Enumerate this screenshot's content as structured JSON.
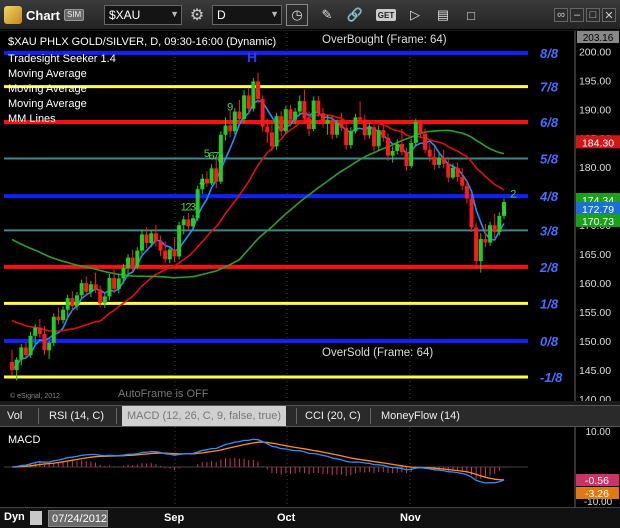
{
  "toolbar": {
    "app_title": "Chart",
    "sim_badge": "SIM",
    "symbol": "$XAU",
    "interval": "D",
    "get_label": "GET"
  },
  "price_header": {
    "line1": "$XAU PHLX GOLD/SILVER, D, 09:30-16:00 (Dynamic)",
    "studies": [
      "Tradesight Seeker 1.4",
      "Moving Average",
      "Moving Average",
      "Moving Average",
      "MM Lines"
    ],
    "overbought": "OverBought (Frame: 64)",
    "oversold": "OverSold (Frame: 64)",
    "autoframe": "AutoFrame is OFF",
    "copyright": "© eSignal, 2012",
    "h_marker": "H"
  },
  "study_tabs": [
    {
      "label": "Vol",
      "active": false
    },
    {
      "label": "RSI (14, C)",
      "active": false
    },
    {
      "label": "MACD (12, 26, C, 9, false, true)",
      "active": true
    },
    {
      "label": "CCI (20, C)",
      "active": false
    },
    {
      "label": "MoneyFlow (14)",
      "active": false
    }
  ],
  "macd_panel": {
    "label": "MACD",
    "scale_top": "10.00",
    "scale_bottom": "-10.00",
    "macd_value": "-0.56",
    "signal_value": "-3.26"
  },
  "bottom_bar": {
    "dyn_label": "Dyn",
    "date": "07/24/2012",
    "months": [
      "Sep",
      "Oct",
      "Nov"
    ]
  },
  "colors": {
    "up": "#22cc22",
    "down": "#ff1a1a",
    "ma_fast": "#1e90ff",
    "ma_mid": "#e01010",
    "ma_slow": "#2e9e2e",
    "mm_blue": "#1020ff",
    "mm_yellow": "#ffff40",
    "mm_red": "#ff1010",
    "mm_teal": "#3a8a8a"
  },
  "chart_data": {
    "type": "candlestick",
    "title": "$XAU PHLX GOLD/SILVER, D, 09:30-16:00 (Dynamic)",
    "ylim": [
      140.0,
      203.16
    ],
    "y_ticks": [
      140,
      145,
      150,
      155,
      160,
      165,
      170,
      175,
      180,
      185,
      190,
      195,
      200
    ],
    "last_label": "203.16",
    "x_labels": [
      "Sep",
      "Oct",
      "Nov"
    ],
    "murrey_math_lines": [
      {
        "label": "8/8",
        "value": 199.7,
        "color": "blue"
      },
      {
        "label": "7/8",
        "value": 193.9,
        "color": "yellow"
      },
      {
        "label": "6/8",
        "value": 187.8,
        "color": "red"
      },
      {
        "label": "5/8",
        "value": 181.5,
        "color": "teal"
      },
      {
        "label": "4/8",
        "value": 175.0,
        "color": "blue"
      },
      {
        "label": "3/8",
        "value": 169.1,
        "color": "teal"
      },
      {
        "label": "2/8",
        "value": 162.8,
        "color": "red"
      },
      {
        "label": "1/8",
        "value": 156.5,
        "color": "yellow"
      },
      {
        "label": "0/8",
        "value": 150.0,
        "color": "blue"
      },
      {
        "label": "-1/8",
        "value": 143.8,
        "color": "yellow"
      }
    ],
    "price_tags": [
      {
        "value": 184.3,
        "label": "184.30",
        "color": "red"
      },
      {
        "value": 174.34,
        "label": "174.34",
        "color": "green"
      },
      {
        "value": 172.79,
        "label": "172.79",
        "color": "blue"
      },
      {
        "value": 170.73,
        "label": "170.73",
        "color": "green"
      }
    ],
    "seeker_counts": [
      {
        "bar": 37,
        "text": "1",
        "value": 172.5
      },
      {
        "bar": 38,
        "text": "2",
        "value": 172.5
      },
      {
        "bar": 39,
        "text": "3",
        "value": 172.5
      },
      {
        "bar": 41,
        "text": "4",
        "value": 176.8
      },
      {
        "bar": 42,
        "text": "5",
        "value": 181.8
      },
      {
        "bar": 43,
        "text": "6",
        "value": 181.3
      },
      {
        "bar": 44,
        "text": "7",
        "value": 181.3
      },
      {
        "bar": 45,
        "text": "8",
        "value": 180.8
      },
      {
        "bar": 47,
        "text": "9",
        "value": 189.8
      },
      {
        "bar": 106,
        "text": "1",
        "value": 172.0
      },
      {
        "bar": 108,
        "text": "2",
        "value": 174.8
      }
    ],
    "candles": [
      [
        146.4,
        148.5,
        144.1,
        145.0
      ],
      [
        145.0,
        147.2,
        143.2,
        146.8
      ],
      [
        146.8,
        149.5,
        145.8,
        148.9
      ],
      [
        148.9,
        149.8,
        147.0,
        147.6
      ],
      [
        147.6,
        151.6,
        147.1,
        150.9
      ],
      [
        150.9,
        152.9,
        149.5,
        152.3
      ],
      [
        152.3,
        153.8,
        150.5,
        151.2
      ],
      [
        151.2,
        152.6,
        147.6,
        148.4
      ],
      [
        148.4,
        150.1,
        146.9,
        149.7
      ],
      [
        149.7,
        154.8,
        149.1,
        154.2
      ],
      [
        154.2,
        155.8,
        152.9,
        153.6
      ],
      [
        153.6,
        156.0,
        153.0,
        155.4
      ],
      [
        155.4,
        158.0,
        154.2,
        157.4
      ],
      [
        157.4,
        158.6,
        155.2,
        156.0
      ],
      [
        156.0,
        158.5,
        155.3,
        157.9
      ],
      [
        157.9,
        160.6,
        157.2,
        160.0
      ],
      [
        160.0,
        161.2,
        157.8,
        158.5
      ],
      [
        158.5,
        160.4,
        157.6,
        159.8
      ],
      [
        159.8,
        161.8,
        158.3,
        158.9
      ],
      [
        158.9,
        159.6,
        155.8,
        156.5
      ],
      [
        156.5,
        158.2,
        155.7,
        157.7
      ],
      [
        157.7,
        161.6,
        157.0,
        160.9
      ],
      [
        160.9,
        162.4,
        158.2,
        159.0
      ],
      [
        159.0,
        161.6,
        158.2,
        160.8
      ],
      [
        160.8,
        163.3,
        159.9,
        162.6
      ],
      [
        162.6,
        165.0,
        161.1,
        164.4
      ],
      [
        164.4,
        165.8,
        162.0,
        162.8
      ],
      [
        162.8,
        166.2,
        162.4,
        165.6
      ],
      [
        165.6,
        169.2,
        165.0,
        168.4
      ],
      [
        168.4,
        169.6,
        166.0,
        166.9
      ],
      [
        166.9,
        169.2,
        166.2,
        168.6
      ],
      [
        168.6,
        170.0,
        166.3,
        167.2
      ],
      [
        167.2,
        168.2,
        164.7,
        165.6
      ],
      [
        165.6,
        167.2,
        163.4,
        164.1
      ],
      [
        164.1,
        166.2,
        163.4,
        165.8
      ],
      [
        165.8,
        167.9,
        163.6,
        164.6
      ],
      [
        164.6,
        170.6,
        164.1,
        170.0
      ],
      [
        170.0,
        171.6,
        168.4,
        171.0
      ],
      [
        171.0,
        172.1,
        169.2,
        169.8
      ],
      [
        169.8,
        171.8,
        169.4,
        171.2
      ],
      [
        171.2,
        176.8,
        170.7,
        176.2
      ],
      [
        176.2,
        178.8,
        175.4,
        178.0
      ],
      [
        178.0,
        179.3,
        176.6,
        177.2
      ],
      [
        177.2,
        180.5,
        176.9,
        179.8
      ],
      [
        179.8,
        181.8,
        176.4,
        177.5
      ],
      [
        177.5,
        186.2,
        177.1,
        185.6
      ],
      [
        185.6,
        188.6,
        184.6,
        187.2
      ],
      [
        187.2,
        189.8,
        185.2,
        186.2
      ],
      [
        186.2,
        190.2,
        185.7,
        189.6
      ],
      [
        189.6,
        191.6,
        187.5,
        188.3
      ],
      [
        188.3,
        193.3,
        187.6,
        192.4
      ],
      [
        192.4,
        193.7,
        189.2,
        190.1
      ],
      [
        190.1,
        195.4,
        189.6,
        194.8
      ],
      [
        194.8,
        196.3,
        191.0,
        191.8
      ],
      [
        191.8,
        192.4,
        186.2,
        187.0
      ],
      [
        187.0,
        188.4,
        184.2,
        186.0
      ],
      [
        186.0,
        187.8,
        182.8,
        183.6
      ],
      [
        183.6,
        189.4,
        183.0,
        188.8
      ],
      [
        188.8,
        189.6,
        185.4,
        186.2
      ],
      [
        186.2,
        190.6,
        185.8,
        190.0
      ],
      [
        190.0,
        190.8,
        187.0,
        188.2
      ],
      [
        188.2,
        190.2,
        187.4,
        189.6
      ],
      [
        189.6,
        192.4,
        189.0,
        191.4
      ],
      [
        191.4,
        193.4,
        187.6,
        188.4
      ],
      [
        188.4,
        189.6,
        185.4,
        186.6
      ],
      [
        186.6,
        192.2,
        186.2,
        191.5
      ],
      [
        191.5,
        192.3,
        188.7,
        189.3
      ],
      [
        189.3,
        190.2,
        186.8,
        187.5
      ],
      [
        187.5,
        189.0,
        185.6,
        188.2
      ],
      [
        188.2,
        188.8,
        184.8,
        185.6
      ],
      [
        185.6,
        188.2,
        185.0,
        187.6
      ],
      [
        187.6,
        189.4,
        186.2,
        186.8
      ],
      [
        186.8,
        187.4,
        183.0,
        183.8
      ],
      [
        183.8,
        186.9,
        183.2,
        186.2
      ],
      [
        186.2,
        189.2,
        185.8,
        188.6
      ],
      [
        188.6,
        191.4,
        187.6,
        188.2
      ],
      [
        188.2,
        189.0,
        184.7,
        185.5
      ],
      [
        185.5,
        187.6,
        184.9,
        186.9
      ],
      [
        186.9,
        187.6,
        182.7,
        183.6
      ],
      [
        183.6,
        187.2,
        183.0,
        186.4
      ],
      [
        186.4,
        187.2,
        184.4,
        185.1
      ],
      [
        185.1,
        185.8,
        181.1,
        182.0
      ],
      [
        182.0,
        183.6,
        180.8,
        182.8
      ],
      [
        182.8,
        184.8,
        182.2,
        184.0
      ],
      [
        184.0,
        186.6,
        182.0,
        182.6
      ],
      [
        182.6,
        183.4,
        179.4,
        180.2
      ],
      [
        180.2,
        184.9,
        179.8,
        184.2
      ],
      [
        184.2,
        188.4,
        183.6,
        187.8
      ],
      [
        187.8,
        188.2,
        185.0,
        185.8
      ],
      [
        185.8,
        186.6,
        182.4,
        183.0
      ],
      [
        183.0,
        184.2,
        181.0,
        181.8
      ],
      [
        181.8,
        183.6,
        179.6,
        180.4
      ],
      [
        180.4,
        182.4,
        179.8,
        181.6
      ],
      [
        181.6,
        183.0,
        179.8,
        180.6
      ],
      [
        180.6,
        181.8,
        177.4,
        178.2
      ],
      [
        178.2,
        180.6,
        177.9,
        179.9
      ],
      [
        179.9,
        180.8,
        177.5,
        178.3
      ],
      [
        178.3,
        179.9,
        176.0,
        176.8
      ],
      [
        176.8,
        177.9,
        173.8,
        174.6
      ],
      [
        174.6,
        175.6,
        168.8,
        169.6
      ],
      [
        169.6,
        170.4,
        162.4,
        163.8
      ],
      [
        163.8,
        168.6,
        161.8,
        167.6
      ],
      [
        167.6,
        170.2,
        166.2,
        167.0
      ],
      [
        167.0,
        170.6,
        166.4,
        170.0
      ],
      [
        170.0,
        172.0,
        167.8,
        168.8
      ],
      [
        168.8,
        172.2,
        168.2,
        171.6
      ],
      [
        171.6,
        174.6,
        171.0,
        174.0
      ]
    ]
  },
  "macd_chart_data": {
    "type": "line",
    "ylim": [
      -10.0,
      10.0
    ],
    "series": [
      {
        "name": "MACD",
        "color": "blue"
      },
      {
        "name": "Signal",
        "color": "orange"
      }
    ]
  }
}
